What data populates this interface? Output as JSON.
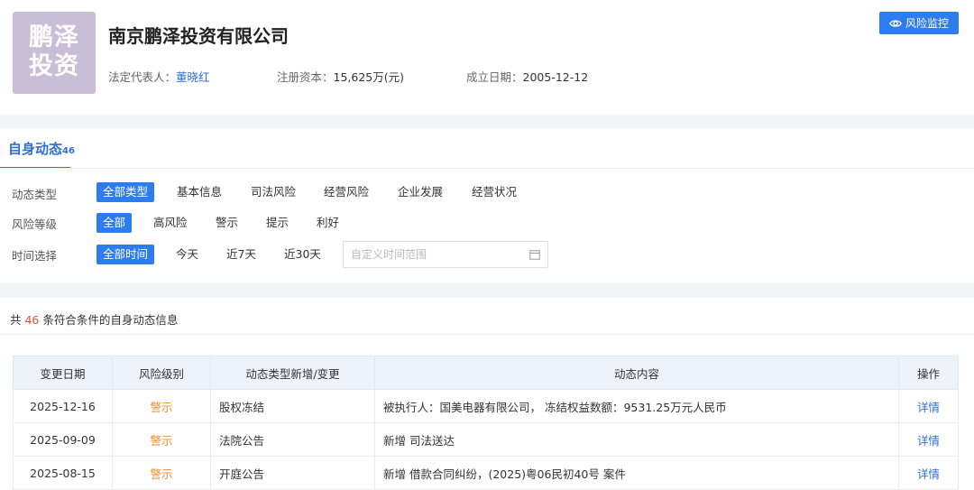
{
  "company": {
    "logo_line1": "鹏泽",
    "logo_line2": "投资",
    "name": "南京鹏泽投资有限公司",
    "legal_rep_label": "法定代表人：",
    "legal_rep": "董晓红",
    "capital_label": "注册资本：",
    "capital": "15,625万(元)",
    "founded_label": "成立日期：",
    "founded": "2005-12-12"
  },
  "monitor_button": "风险监控",
  "tab": {
    "label": "自身动态",
    "count": "46"
  },
  "filters": {
    "type": {
      "label": "动态类型",
      "options": [
        "全部类型",
        "基本信息",
        "司法风险",
        "经营风险",
        "企业发展",
        "经营状况"
      ]
    },
    "risk": {
      "label": "风险等级",
      "options": [
        "全部",
        "高风险",
        "警示",
        "提示",
        "利好"
      ]
    },
    "time": {
      "label": "时间选择",
      "options": [
        "全部时间",
        "今天",
        "近7天",
        "近30天"
      ]
    },
    "date_placeholder": "自定义时间范围"
  },
  "summary": {
    "prefix": "共 ",
    "count": "46",
    "suffix": " 条符合条件的自身动态信息"
  },
  "table": {
    "headers": [
      "变更日期",
      "风险级别",
      "动态类型新增/变更",
      "动态内容",
      "操作"
    ],
    "rows": [
      {
        "date": "2025-12-16",
        "risk": "警示",
        "type": "股权冻结",
        "content": "被执行人：国美电器有限公司， 冻结权益数额：9531.25万元人民币",
        "action": "详情"
      },
      {
        "date": "2025-09-09",
        "risk": "警示",
        "type": "法院公告",
        "content": "新增 司法送达",
        "action": "详情"
      },
      {
        "date": "2025-08-15",
        "risk": "警示",
        "type": "开庭公告",
        "content": "新增 借款合同纠纷，(2025)粤06民初40号 案件",
        "action": "详情"
      }
    ]
  }
}
